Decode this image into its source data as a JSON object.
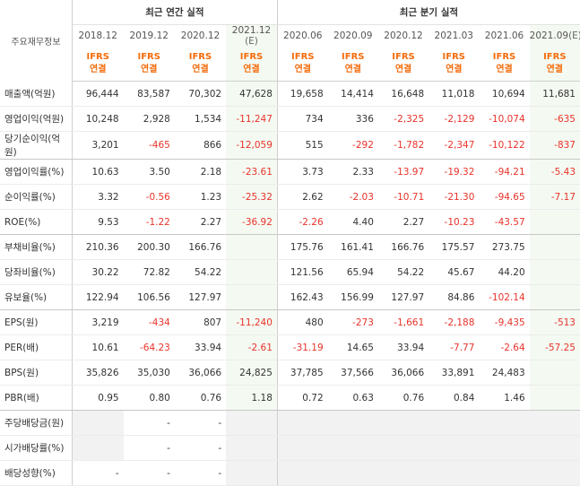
{
  "header": {
    "corner_label": "주요재무정보",
    "annual_group": "최근 연간 실적",
    "quarter_group": "최근 분기 실적",
    "ifrs_top": "IFRS",
    "ifrs_bottom": "연결",
    "estimate_suffix": "(E)",
    "annual_periods": [
      "2018.12",
      "2019.12",
      "2020.12",
      "2021.12"
    ],
    "quarter_periods": [
      "2020.06",
      "2020.09",
      "2020.12",
      "2021.03",
      "2021.06",
      "2021.09"
    ]
  },
  "rows": [
    {
      "label": "매출액(억원)",
      "annual": [
        "96,444",
        "83,587",
        "70,302",
        "47,628"
      ],
      "quarter": [
        "19,658",
        "14,414",
        "16,648",
        "11,018",
        "10,694",
        "11,681"
      ]
    },
    {
      "label": "영업이익(억원)",
      "annual": [
        "10,248",
        "2,928",
        "1,534",
        "-11,247"
      ],
      "quarter": [
        "734",
        "336",
        "-2,325",
        "-2,129",
        "-10,074",
        "-635"
      ]
    },
    {
      "label": "당기순이익(억원)",
      "annual": [
        "3,201",
        "-465",
        "866",
        "-12,059"
      ],
      "quarter": [
        "515",
        "-292",
        "-1,782",
        "-2,347",
        "-10,122",
        "-837"
      ]
    },
    {
      "label": "영업이익률(%)",
      "annual": [
        "10.63",
        "3.50",
        "2.18",
        "-23.61"
      ],
      "quarter": [
        "3.73",
        "2.33",
        "-13.97",
        "-19.32",
        "-94.21",
        "-5.43"
      ]
    },
    {
      "label": "순이익률(%)",
      "annual": [
        "3.32",
        "-0.56",
        "1.23",
        "-25.32"
      ],
      "quarter": [
        "2.62",
        "-2.03",
        "-10.71",
        "-21.30",
        "-94.65",
        "-7.17"
      ]
    },
    {
      "label": "ROE(%)",
      "annual": [
        "9.53",
        "-1.22",
        "2.27",
        "-36.92"
      ],
      "quarter": [
        "-2.26",
        "4.40",
        "2.27",
        "-10.23",
        "-43.57",
        ""
      ]
    },
    {
      "label": "부채비율(%)",
      "annual": [
        "210.36",
        "200.30",
        "166.76",
        ""
      ],
      "quarter": [
        "175.76",
        "161.41",
        "166.76",
        "175.57",
        "273.75",
        ""
      ]
    },
    {
      "label": "당좌비율(%)",
      "annual": [
        "30.22",
        "72.82",
        "54.22",
        ""
      ],
      "quarter": [
        "121.56",
        "65.94",
        "54.22",
        "45.67",
        "44.20",
        ""
      ]
    },
    {
      "label": "유보율(%)",
      "annual": [
        "122.94",
        "106.56",
        "127.97",
        ""
      ],
      "quarter": [
        "162.43",
        "156.99",
        "127.97",
        "84.86",
        "-102.14",
        ""
      ]
    },
    {
      "label": "EPS(원)",
      "annual": [
        "3,219",
        "-434",
        "807",
        "-11,240"
      ],
      "quarter": [
        "480",
        "-273",
        "-1,661",
        "-2,188",
        "-9,435",
        "-513"
      ]
    },
    {
      "label": "PER(배)",
      "annual": [
        "10.61",
        "-64.23",
        "33.94",
        "-2.61"
      ],
      "quarter": [
        "-31.19",
        "14.65",
        "33.94",
        "-7.77",
        "-2.64",
        "-57.25"
      ]
    },
    {
      "label": "BPS(원)",
      "annual": [
        "35,826",
        "35,030",
        "36,066",
        "24,825"
      ],
      "quarter": [
        "37,785",
        "37,566",
        "36,066",
        "33,891",
        "24,483",
        ""
      ]
    },
    {
      "label": "PBR(배)",
      "annual": [
        "0.95",
        "0.80",
        "0.76",
        "1.18"
      ],
      "quarter": [
        "0.72",
        "0.63",
        "0.76",
        "0.84",
        "1.46",
        ""
      ]
    },
    {
      "label": "주당배당금(원)",
      "annual": [
        "",
        "-",
        "-",
        ""
      ],
      "quarter": [
        "",
        "",
        "",
        "",
        "",
        ""
      ]
    },
    {
      "label": "시가배당률(%)",
      "annual": [
        "",
        "-",
        "-",
        ""
      ],
      "quarter": [
        "",
        "",
        "",
        "",
        "",
        ""
      ]
    },
    {
      "label": "배당성향(%)",
      "annual": [
        "-",
        "-",
        "-",
        ""
      ],
      "quarter": [
        "",
        "",
        "",
        "",
        "",
        ""
      ]
    }
  ],
  "group_breaks_after": [
    2,
    5,
    8,
    12
  ],
  "grey_from_row": 13,
  "colors": {
    "negative": "#e8332a",
    "ifrs": "#f46c0c",
    "estimate_bg": "#f4faf2",
    "grey_bg": "#f2f2f2"
  }
}
